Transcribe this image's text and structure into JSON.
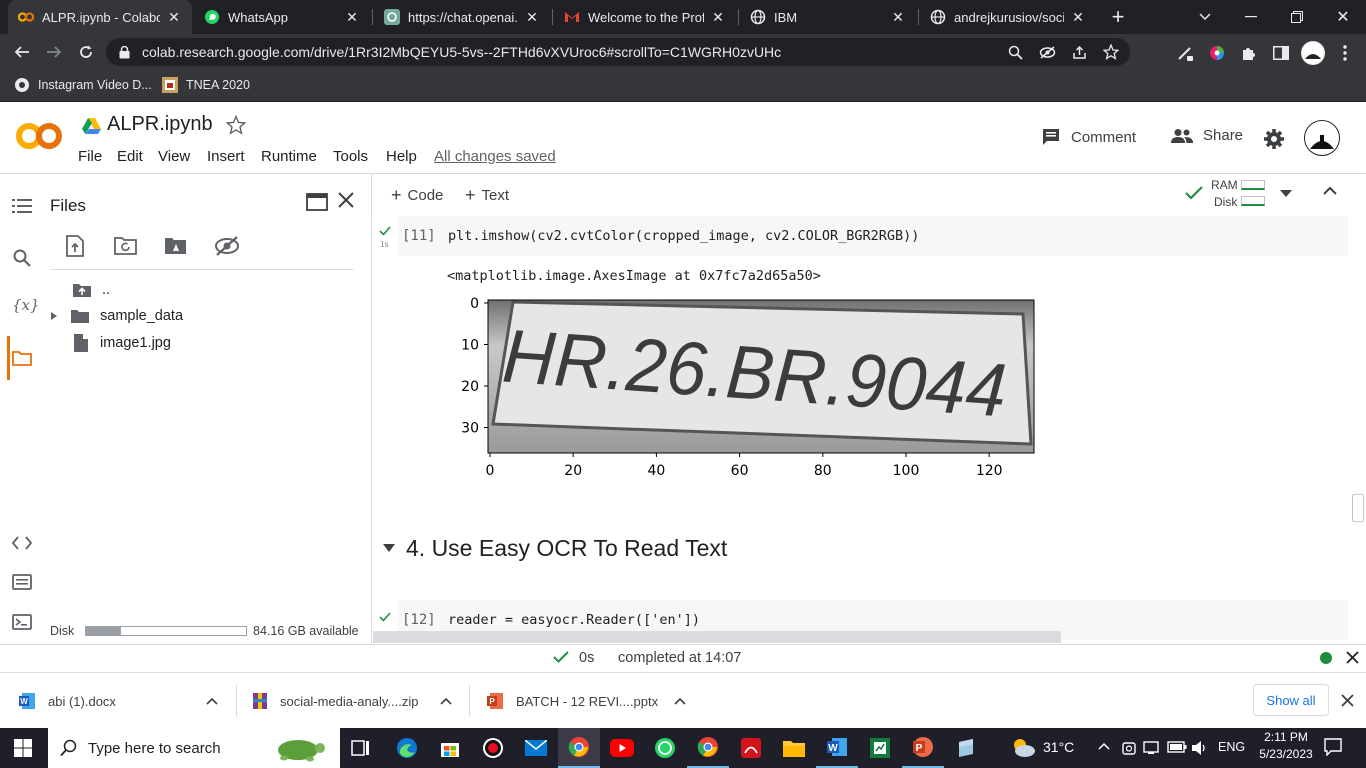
{
  "browser": {
    "tabs": [
      {
        "title": "ALPR.ipynb - Colabora",
        "icon": "colab-icon",
        "active": true
      },
      {
        "title": "WhatsApp",
        "icon": "whatsapp-icon"
      },
      {
        "title": "https://chat.openai.co",
        "icon": "openai-icon"
      },
      {
        "title": "Welcome to the Profe",
        "icon": "gmail-icon"
      },
      {
        "title": "IBM",
        "icon": "globe-icon"
      },
      {
        "title": "andrejkurusiov/social-",
        "icon": "globe-icon"
      }
    ],
    "url": "colab.research.google.com/drive/1Rr3I2MbQEYU5-5vs--2FTHd6vXVUroc6#scrollTo=C1WGRH0zvUHc",
    "bookmarks": [
      {
        "label": "Instagram Video D...",
        "icon": "instagram-icon"
      },
      {
        "label": "TNEA 2020",
        "icon": "bookmark-image-icon"
      }
    ]
  },
  "colab": {
    "logo": "CO",
    "notebook_title": "ALPR.ipynb",
    "menu": [
      "File",
      "Edit",
      "View",
      "Insert",
      "Runtime",
      "Tools",
      "Help"
    ],
    "save_status": "All changes saved",
    "comment_label": "Comment",
    "share_label": "Share",
    "toolbar": {
      "code_label": "Code",
      "text_label": "Text",
      "ram_label": "RAM",
      "disk_label": "Disk"
    }
  },
  "files_panel": {
    "title": "Files",
    "items": [
      {
        "name": "..",
        "type": "parent"
      },
      {
        "name": "sample_data",
        "type": "folder"
      },
      {
        "name": "image1.jpg",
        "type": "file"
      }
    ],
    "disk_label": "Disk",
    "disk_available": "84.16 GB available",
    "disk_used_fraction": 0.22
  },
  "cells": [
    {
      "exec_count": "[11]",
      "run_time": "1s",
      "code": "plt.imshow(cv2.cvtColor(cropped_image, cv2.COLOR_BGR2RGB))",
      "output_text": "<matplotlib.image.AxesImage at 0x7fc7a2d65a50>",
      "plate_text": "HR.26.BR.9044",
      "y_ticks": [
        "0",
        "10",
        "20",
        "30"
      ],
      "x_ticks": [
        "0",
        "20",
        "40",
        "60",
        "80",
        "100",
        "120"
      ]
    },
    {
      "heading": "4. Use Easy OCR To Read Text"
    },
    {
      "exec_count": "[12]",
      "code": "reader = easyocr.Reader(['en'])"
    }
  ],
  "status_bar": {
    "time": "0s",
    "message": "completed at 14:07"
  },
  "downloads": [
    {
      "name": "abi (1).docx",
      "icon": "word-file-icon"
    },
    {
      "name": "social-media-analy....zip",
      "icon": "zip-file-icon"
    },
    {
      "name": "BATCH - 12  REVI....pptx",
      "icon": "pptx-file-icon"
    }
  ],
  "downloads_show_all": "Show all",
  "taskbar": {
    "search_placeholder": "Type here to search",
    "weather": "31°C",
    "language": "ENG",
    "time": "2:11 PM",
    "date": "5/23/2023"
  }
}
